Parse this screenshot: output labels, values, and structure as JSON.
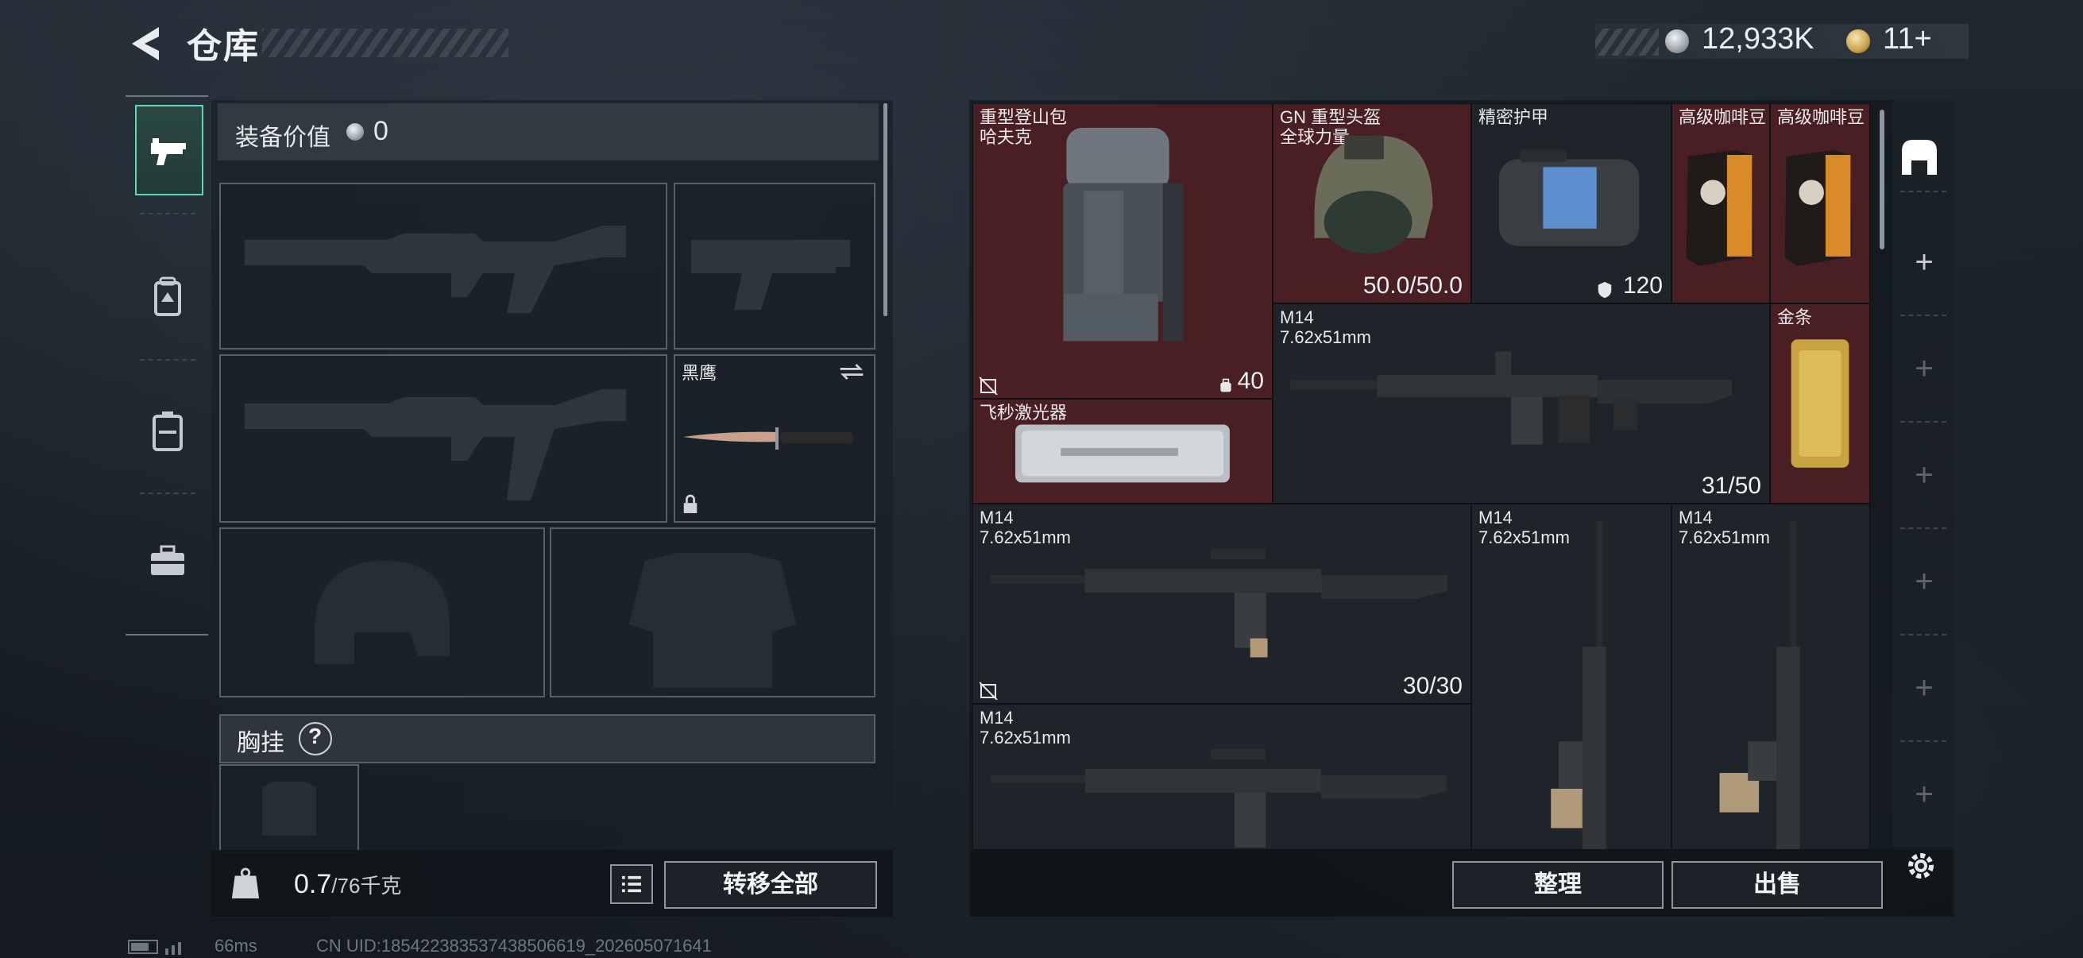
{
  "header": {
    "title": "仓库"
  },
  "currency": {
    "silver": "12,933K",
    "gold": "11+"
  },
  "left_panel": {
    "equip_value_label": "装备价值",
    "equip_value": "0",
    "knife_name": "黑鹰",
    "chest_rig_label": "胸挂",
    "help_glyph": "?",
    "weight_value": "0.7",
    "weight_max": "/76千克",
    "transfer_all": "转移全部"
  },
  "grid_items": [
    {
      "name": "重型登山包",
      "sub": "哈夫克",
      "value": "40",
      "icon": "backpack-capacity-icon"
    },
    {
      "name": "GN 重型头盔",
      "sub": "全球力量",
      "value": "50.0/50.0"
    },
    {
      "name": "精密护甲",
      "sub": "",
      "value": "120",
      "icon": "armor-shield-icon"
    },
    {
      "name": "高级咖啡豆",
      "sub": ""
    },
    {
      "name": "高级咖啡豆",
      "sub": ""
    },
    {
      "name": "M14",
      "sub": "7.62x51mm",
      "value": "31/50"
    },
    {
      "name": "金条",
      "sub": ""
    },
    {
      "name": "飞秒激光器",
      "sub": ""
    },
    {
      "name": "M14",
      "sub": "7.62x51mm",
      "value": "30/30"
    },
    {
      "name": "M14",
      "sub": "7.62x51mm"
    },
    {
      "name": "M14",
      "sub": "7.62x51mm"
    },
    {
      "name": "M14",
      "sub": "7.62x51mm"
    }
  ],
  "buttons": {
    "sort": "整理",
    "sell": "出售"
  },
  "sidebar": {
    "plus": "+"
  },
  "status_bar": {
    "ping": "66ms",
    "uid": "CN UID:18542238353743850​6619_202605071641"
  },
  "colors": {
    "accent": "#5fd6b8",
    "rare_item_bg": "#4a1f24",
    "cell_bg": "#1e2429"
  }
}
